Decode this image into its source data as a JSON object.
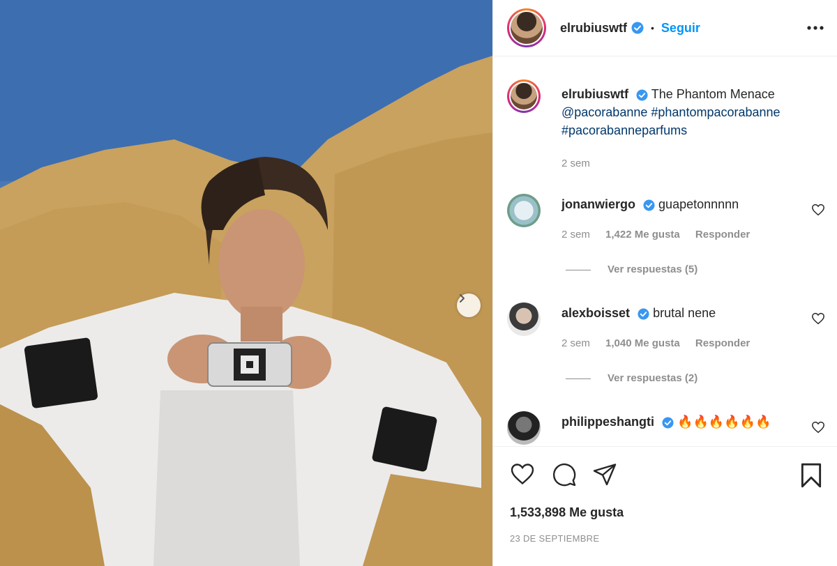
{
  "post": {
    "username": "elrubiuswtf",
    "follow_label": "Seguir",
    "separator": "•",
    "likes_count": "1,533,898",
    "likes_label": "Me gusta",
    "date": "23 DE SEPTIEMBRE"
  },
  "caption": {
    "username": "elrubiuswtf",
    "text": "The Phantom Menace",
    "mention": "@pacorabanne",
    "hashtag1": "#phantompacorabanne",
    "hashtag2": "#pacorabanneparfums",
    "time": "2 sem"
  },
  "comments": [
    {
      "username": "jonanwiergo",
      "text": "guapetonnnnn",
      "time": "2 sem",
      "likes": "1,422 Me gusta",
      "reply": "Responder",
      "view_replies": "Ver respuestas (5)"
    },
    {
      "username": "alexboisset",
      "text": "brutal nene",
      "time": "2 sem",
      "likes": "1,040 Me gusta",
      "reply": "Responder",
      "view_replies": "Ver respuestas (2)"
    },
    {
      "username": "philippeshangti",
      "text": "🔥🔥🔥🔥🔥🔥"
    }
  ],
  "colors": {
    "follow_blue": "#0095f6",
    "verified_blue": "#3897f0",
    "link_navy": "#00376b",
    "muted_gray": "#8e8e8e"
  },
  "icons": [
    "verified-badge-icon",
    "more-options-icon",
    "heart-icon",
    "comment-icon",
    "share-icon",
    "bookmark-icon",
    "chevron-right-icon"
  ]
}
